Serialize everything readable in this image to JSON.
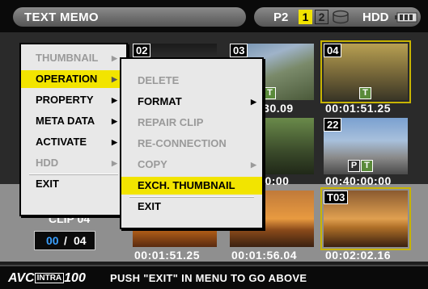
{
  "header": {
    "title": "TEXT MEMO",
    "card_label": "P2",
    "slot1": "1",
    "slot2": "2",
    "hdd_label": "HDD",
    "icons": [
      "disk-icon",
      "battery-icon"
    ]
  },
  "main_menu": {
    "items": [
      {
        "label": "THUMBNAIL",
        "state": "disabled",
        "submenu": true
      },
      {
        "label": "OPERATION",
        "state": "highlighted",
        "submenu": true
      },
      {
        "label": "PROPERTY",
        "state": "enabled",
        "submenu": true
      },
      {
        "label": "META DATA",
        "state": "enabled",
        "submenu": true
      },
      {
        "label": "ACTIVATE",
        "state": "enabled",
        "submenu": true
      },
      {
        "label": "HDD",
        "state": "disabled",
        "submenu": true
      },
      {
        "label": "EXIT",
        "state": "enabled",
        "submenu": false
      }
    ]
  },
  "sub_menu": {
    "items": [
      {
        "label": "DELETE",
        "state": "disabled",
        "submenu": false
      },
      {
        "label": "FORMAT",
        "state": "enabled",
        "submenu": true
      },
      {
        "label": "REPAIR CLIP",
        "state": "disabled",
        "submenu": false
      },
      {
        "label": "RE-CONNECTION",
        "state": "disabled",
        "submenu": false
      },
      {
        "label": "COPY",
        "state": "disabled",
        "submenu": true
      },
      {
        "label": "EXCH. THUMBNAIL",
        "state": "highlighted",
        "submenu": false
      },
      {
        "label": "EXIT",
        "state": "enabled",
        "submenu": false
      }
    ]
  },
  "thumbnails": [
    {
      "number": "02",
      "timecode": ""
    },
    {
      "number": "03",
      "timecode": ":30.09",
      "badges": [
        "T"
      ]
    },
    {
      "number": "04",
      "timecode": "00:01:51.25",
      "badges": [
        "T"
      ],
      "selected": true
    },
    {
      "number": "",
      "timecode": ":00:00"
    },
    {
      "number": "",
      "timecode": ":00:00"
    },
    {
      "number": "22",
      "timecode": "00:40:00:00",
      "badges": [
        "P",
        "T"
      ]
    },
    {
      "number": "",
      "timecode": "00:01:51.25"
    },
    {
      "number": "",
      "timecode": "00:01:56.04"
    },
    {
      "number": "T03",
      "timecode": "00:02:02.16",
      "selected": true
    }
  ],
  "clip_info": {
    "label": "CLIP 04",
    "current": "00",
    "separator": "/",
    "total": "04"
  },
  "footer": {
    "logo_avc": "AVC",
    "logo_intra": "INTRA",
    "logo_num": "100",
    "message": "PUSH \"EXIT\" IN MENU TO GO ABOVE"
  },
  "colors": {
    "highlight": "#f2e400",
    "selection_border": "#c8b400",
    "disabled_text": "#9a9a9a",
    "accent_counter": "#3aa0ff"
  }
}
